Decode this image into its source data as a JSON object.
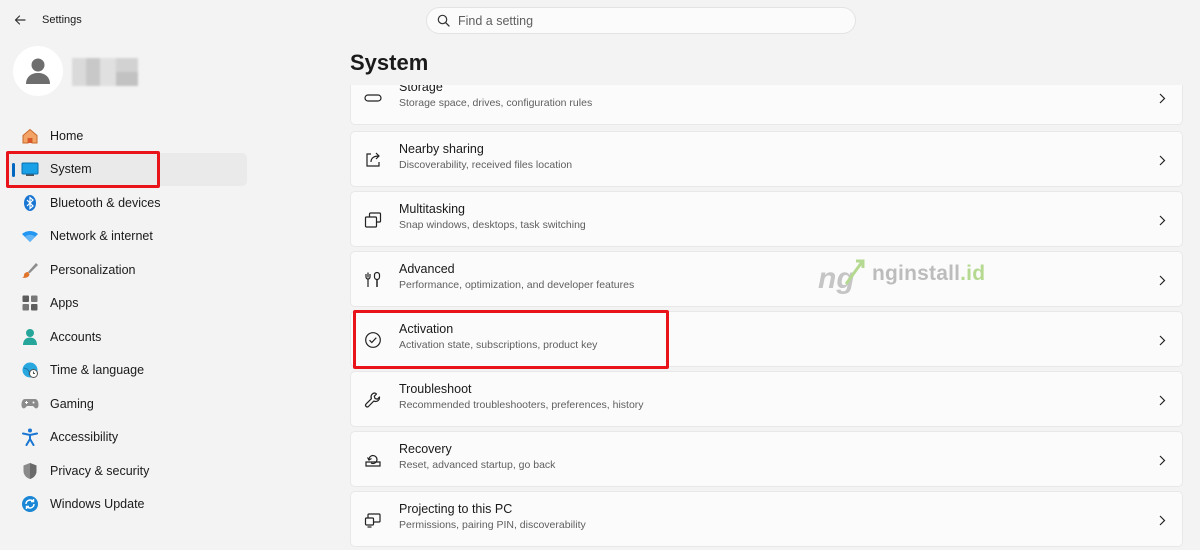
{
  "window": {
    "title": "Settings"
  },
  "search": {
    "placeholder": "Find a setting"
  },
  "sidebar": {
    "items": [
      {
        "label": "Home"
      },
      {
        "label": "System"
      },
      {
        "label": "Bluetooth & devices"
      },
      {
        "label": "Network & internet"
      },
      {
        "label": "Personalization"
      },
      {
        "label": "Apps"
      },
      {
        "label": "Accounts"
      },
      {
        "label": "Time & language"
      },
      {
        "label": "Gaming"
      },
      {
        "label": "Accessibility"
      },
      {
        "label": "Privacy & security"
      },
      {
        "label": "Windows Update"
      }
    ]
  },
  "main": {
    "title": "System",
    "cards": [
      {
        "title": "Storage",
        "subtitle": "Storage space, drives, configuration rules",
        "icon": "storage-icon"
      },
      {
        "title": "Nearby sharing",
        "subtitle": "Discoverability, received files location",
        "icon": "share-icon"
      },
      {
        "title": "Multitasking",
        "subtitle": "Snap windows, desktops, task switching",
        "icon": "multitasking-icon"
      },
      {
        "title": "Advanced",
        "subtitle": "Performance, optimization, and developer features",
        "icon": "tools-icon"
      },
      {
        "title": "Activation",
        "subtitle": "Activation state, subscriptions, product key",
        "icon": "check-circle-icon"
      },
      {
        "title": "Troubleshoot",
        "subtitle": "Recommended troubleshooters, preferences, history",
        "icon": "wrench-icon"
      },
      {
        "title": "Recovery",
        "subtitle": "Reset, advanced startup, go back",
        "icon": "recovery-icon"
      },
      {
        "title": "Projecting to this PC",
        "subtitle": "Permissions, pairing PIN, discoverability",
        "icon": "projecting-icon"
      }
    ]
  },
  "watermark": {
    "brand": "nginstall",
    "suffix": ".id",
    "logo_text": "ng"
  },
  "colors": {
    "accent": "#0067c0",
    "highlight": "#e8141a",
    "background": "#f3f3f3",
    "card": "#fbfbfb"
  }
}
